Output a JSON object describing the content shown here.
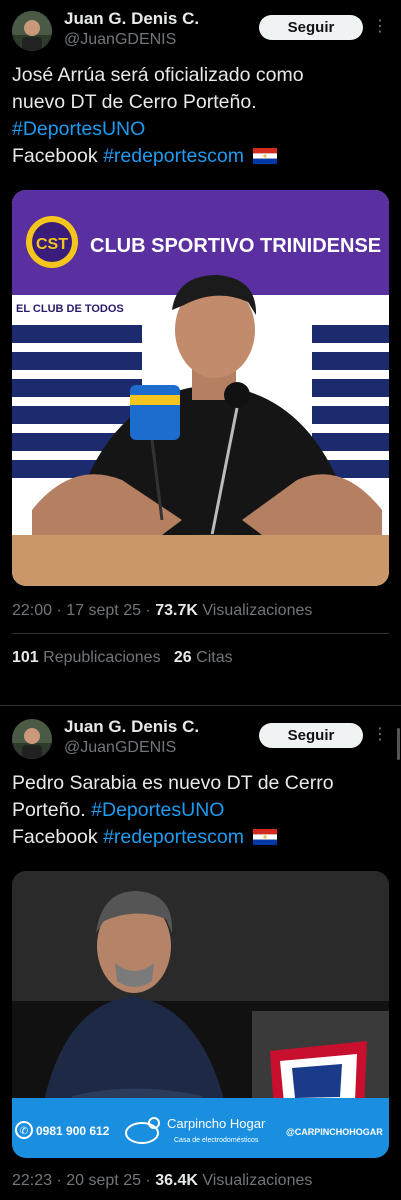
{
  "tweets": [
    {
      "author_name": "Juan G. Denis C.",
      "handle": "@JuanGDENIS",
      "follow_label": "Seguir",
      "more_label": "⋮",
      "line1": "José Arrúa será oficializado como",
      "line2": "nuevo DT de Cerro Porteño.",
      "hashtag": "#DeportesUNO",
      "facebook_label": "Facebook",
      "facebook_tag": "#redeportescom",
      "banner_text": "CLUB SPORTIVO TRINIDENSE",
      "board_text": "EL CLUB DE TODOS",
      "time": "22:00",
      "date": "17 sept 25",
      "views_count": "73.7K",
      "views_label": "Visualizaciones",
      "reposts_count": "101",
      "reposts_label": "Republicaciones",
      "quotes_count": "26",
      "quotes_label": "Citas"
    },
    {
      "author_name": "Juan G. Denis C.",
      "handle": "@JuanGDENIS",
      "follow_label": "Seguir",
      "more_label": "⋮",
      "line1": "Pedro Sarabia es nuevo DT de Cerro",
      "line2_prefix": "Porteño.",
      "hashtag": "#DeportesUNO",
      "facebook_label": "Facebook",
      "facebook_tag": "#redeportescom",
      "ad_phone": "0981 900 612",
      "ad_brand": "Carpincho Hogar",
      "ad_sub": "Casa de electrodomésticos",
      "ad_handle": "@CARPINCHOHOGAR",
      "time": "22:23",
      "date": "20 sept 25",
      "views_count": "36.4K",
      "views_label": "Visualizaciones"
    }
  ],
  "colors": {
    "link": "#1d9bf0",
    "muted": "#71767b",
    "text": "#e7e9ea",
    "background": "#000000"
  },
  "icons": [
    "more-icon",
    "paraguay-flag-icon",
    "phone-icon",
    "capybara-icon"
  ]
}
